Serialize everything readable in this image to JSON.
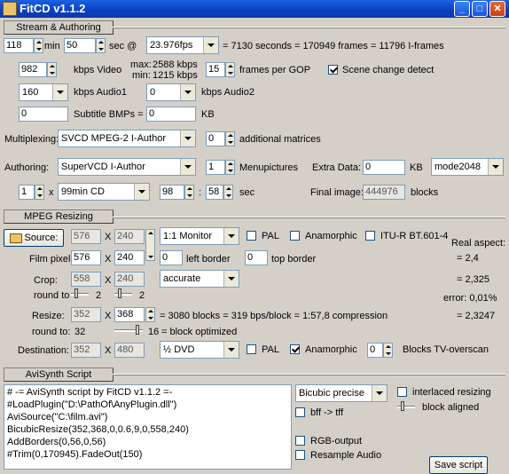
{
  "window": {
    "title": "FitCD v1.1.2",
    "min_label": "_",
    "max_label": "□",
    "close_label": "✕"
  },
  "sections": {
    "stream": "Stream & Authoring",
    "mpeg": "MPEG Resizing",
    "avisynth": "AviSynth Script"
  },
  "stream": {
    "minutes": "118",
    "min_label": "min",
    "seconds": "50",
    "sec_label": "sec @",
    "fps": "23.976fps",
    "summary": "= 7130 seconds = 170949 frames = 11796 I-frames",
    "video_kbps": "982",
    "video_label": "kbps Video",
    "max_label": "max:",
    "max_val": "2588 kbps",
    "min2_label": "min:",
    "min_val": "1215 kbps",
    "gop": "15",
    "gop_label": "frames per GOP",
    "scene_detect": "Scene change detect",
    "audio1": "160",
    "audio1_label": "kbps Audio1",
    "audio2": "0",
    "audio2_label": "kbps Audio2",
    "subtitle": "0",
    "subtitle_label": "Subtitle BMPs =",
    "subtitle_kb": "0",
    "kb_label": "KB",
    "mux_label": "Multiplexing:",
    "mux": "SVCD MPEG-2 I-Author",
    "matrices": "0",
    "matrices_label": "additional matrices",
    "auth_label": "Authoring:",
    "auth": "SuperVCD I-Author",
    "menupics": "1",
    "menupics_label": "Menupictures",
    "extra_label": "Extra Data:",
    "extra": "0",
    "extra_kb": "KB",
    "mode": "mode2048",
    "discs": "1",
    "x_label": "x",
    "disc": "99min CD",
    "t_min": "98",
    "colon": ":",
    "t_sec": "58",
    "t_sec_label": "sec",
    "final_label": "Final image:",
    "final": "444976",
    "blocks_label": "blocks"
  },
  "mpeg": {
    "source_btn": "Source:",
    "src_w": "576",
    "x": "X",
    "src_h": "240",
    "monitor": "1:1 Monitor",
    "pal": "PAL",
    "anamorphic": "Anamorphic",
    "itu": "ITU-R BT.601-4",
    "real_aspect": "Real aspect:",
    "aspect_val": "= 2,4",
    "film_label": "Film pixel:",
    "film_w": "576",
    "film_h": "240",
    "left_border": "0",
    "left_border_label": "left border",
    "top_border": "0",
    "top_border_label": "top border",
    "crop_label": "Crop:",
    "crop_w": "558",
    "crop_h": "240",
    "crop_mode": "accurate",
    "crop_aspect": "= 2,325",
    "round_label": "round to",
    "round1": "2",
    "round2": "2",
    "error": "error: 0,01%",
    "resize_label": "Resize:",
    "resize_w": "352",
    "resize_h": "368",
    "resize_info": "= 3080 blocks = 319 bps/block = 1:57,8 compression",
    "resize_aspect": "= 2,3247",
    "round2_label": "round to:",
    "round_to_val": "32",
    "round_to_val2": "16",
    "block_opt": "= block optimized",
    "dest_label": "Destination:",
    "dest_w": "352",
    "dest_h": "480",
    "dvd": "½ DVD",
    "dest_pal": "PAL",
    "dest_anamorphic": "Anamorphic",
    "overscan": "0",
    "overscan_label": "Blocks TV-overscan"
  },
  "avisynth": {
    "lines": [
      "# -= AviSynth script by FitCD v1.1.2 =-",
      "#LoadPlugin(\"D:\\PathOf\\AnyPlugin.dll\")",
      "AviSource(\"C:\\film.avi\")",
      "BicubicResize(352,368,0,0.6,9,0,558,240)",
      "AddBorders(0,56,0,56)",
      "#Trim(0,170945).FadeOut(150)"
    ],
    "resize_method": "Bicubic precise",
    "interlaced": "interlaced resizing",
    "bff": "bff -> tff",
    "block_aligned": "block aligned",
    "rgb": "RGB-output",
    "resample": "Resample Audio",
    "save": "Save script"
  }
}
